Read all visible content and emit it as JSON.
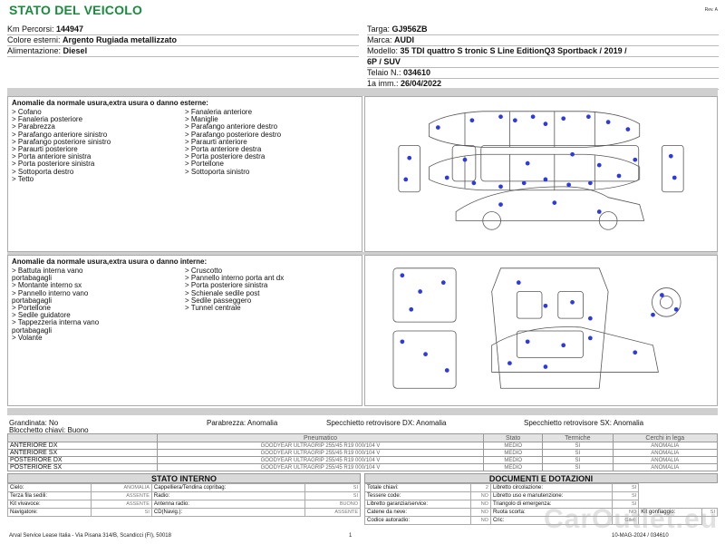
{
  "header": {
    "title": "STATO DEL VEICOLO",
    "rev": "Rev. A"
  },
  "vehicle_left": [
    {
      "label": "Km Percorsi: ",
      "value": "144947"
    },
    {
      "label": "Colore esterni: ",
      "value": "Argento Rugiada metallizzato"
    },
    {
      "label": "Alimentazione: ",
      "value": "Diesel"
    }
  ],
  "vehicle_right": [
    {
      "label": "Targa: ",
      "value": "GJ956ZB"
    },
    {
      "label": "Marca: ",
      "value": "AUDI"
    },
    {
      "label": "Modello: ",
      "value": "35 TDI quattro S tronic S Line EditionQ3 Sportback / 2019 /"
    },
    {
      "label": "",
      "value": "6P / SUV"
    },
    {
      "label": "Telaio N.: ",
      "value": "034610"
    },
    {
      "label": "1a imm.: ",
      "value": "26/04/2022"
    }
  ],
  "external_damage": {
    "heading": "Anomalie da normale usura,extra usura o danno esterne:",
    "col1": [
      "> Cofano",
      "> Fanaleria posteriore",
      "> Parabrezza",
      "> Parafango anteriore sinistro",
      "> Parafango posteriore sinistro",
      "> Paraurti posteriore",
      "> Porta anteriore sinistra",
      "> Porta posteriore sinistra",
      "> Sottoporta destro",
      "> Tetto"
    ],
    "col2": [
      "> Fanaleria anteriore",
      "> Maniglie",
      "> Parafango anteriore destro",
      "> Parafango posteriore destro",
      "> Paraurti anteriore",
      "> Porta anteriore destra",
      "> Porta posteriore destra",
      "> Portellone",
      "> Sottoporta sinistro"
    ]
  },
  "internal_damage": {
    "heading": "Anomalie da normale usura,extra usura o danno interne:",
    "col1": [
      "> Battuta interna vano",
      "portabagagli",
      "> Montante interno sx",
      "> Pannello interno vano",
      "portabagagli",
      "> Portellone",
      "> Sedile guidatore",
      "> Tappezzeria interna vano",
      "portabagagli",
      "> Volante"
    ],
    "col2": [
      "> Cruscotto",
      "> Pannello interno porta ant dx",
      "> Porta posteriore sinistra",
      "> Schienale sedile post",
      "> Sedile passeggero",
      "> Tunnel centrale"
    ]
  },
  "conditions": {
    "grandinata": "Grandinata: No",
    "blocchetto": "Blocchetto chiavi: Buono",
    "parabrezza": "Parabrezza: Anomalia",
    "specchietto_dx": "Specchietto retrovisore DX: Anomalia",
    "specchietto_sx": "Specchietto retrovisore SX: Anomalia"
  },
  "tyres": {
    "headers": [
      "",
      "Pneumatico",
      "Stato",
      "Termiche",
      "Cerchi in lega"
    ],
    "rows": [
      [
        "ANTERIORE DX",
        "GOODYEAR ULTRAGRIP  255/45 R19 000/104 V",
        "MEDIO",
        "SI",
        "ANOMALIA"
      ],
      [
        "ANTERIORE SX",
        "GOODYEAR ULTRAGRIP  255/45 R19 000/104 V",
        "MEDIO",
        "SI",
        "ANOMALIA"
      ],
      [
        "POSTERIORE DX",
        "GOODYEAR ULTRAGRIP  255/45 R19 000/104 V",
        "MEDIO",
        "SI",
        "ANOMALIA"
      ],
      [
        "POSTERIORE SX",
        "GOODYEAR ULTRAGRIP  255/45 R19 000/104 V",
        "MEDIO",
        "SI",
        "ANOMALIA"
      ]
    ]
  },
  "stato_interno": {
    "heading": "STATO INTERNO",
    "rows": [
      [
        "Cielo:",
        "ANOMALIA",
        "Cappelliera/Tendina copribag:",
        "SI"
      ],
      [
        "Terza fila sedili:",
        "ASSENTE",
        "Radio:",
        "SI"
      ],
      [
        "Kit vivavoce:",
        "ASSENTE",
        "Antenna radio:",
        "BUONO"
      ],
      [
        "Navigatore:",
        "SI",
        "CD(Navig.):",
        "ASSENTE"
      ]
    ]
  },
  "documenti": {
    "heading": "DOCUMENTI E DOTAZIONI",
    "rows": [
      [
        "Totale chiavi:",
        "2",
        "Libretto circolazione:",
        "SI"
      ],
      [
        "Tessere code:",
        "NO",
        "Libretto uso e manutenzione:",
        "SI"
      ],
      [
        "Libretto garanzia/service:",
        "NO",
        "Triangolo di emergenza:",
        "SI"
      ],
      [
        "Catene da neve:",
        "NO",
        "Ruota scorta:",
        "NO",
        "Kit gonfiaggio:",
        "SI"
      ],
      [
        "Codice autoradio:",
        "NO",
        "Cric:",
        "Gilet:",
        ""
      ]
    ]
  },
  "footer": {
    "company": "Arval Service Lease Italia - Via Pisana 314/B, Scandicci (FI), 50018",
    "page": "1",
    "ref": "10-MAG-2024 / 034610"
  },
  "watermark": "CarOutlet.eu",
  "colors": {
    "title": "#1a8a3e",
    "marker": "#2d3adf",
    "band": "#cfcfcf"
  }
}
